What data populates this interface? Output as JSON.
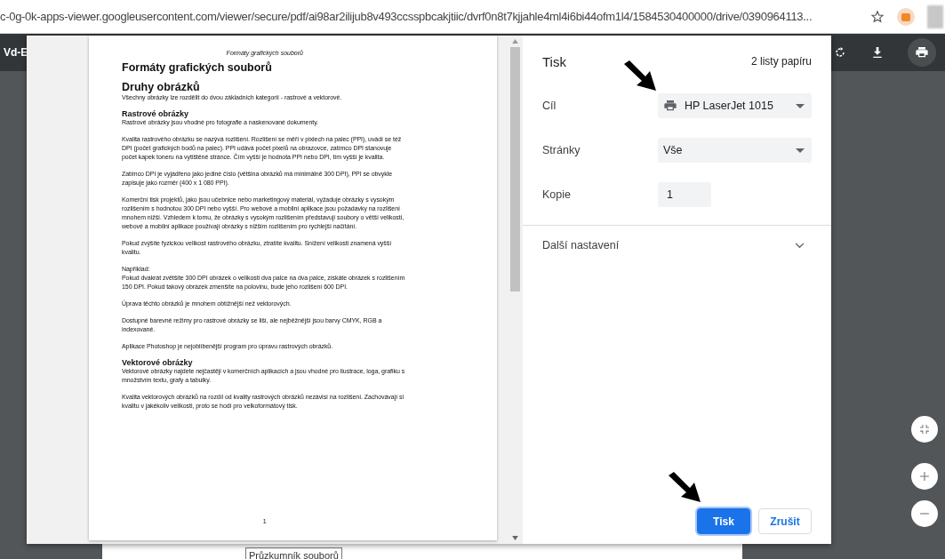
{
  "address_bar": {
    "url": "c-0g-0k-apps-viewer.googleusercontent.com/viewer/secure/pdf/ai98ar2ilijub8v493ccsspbcakjtiic/dvrf0n8t7kjjahle4ml4i6bi44ofm1l4/1584530400000/drive/0390964113..."
  },
  "viewer_toolbar": {
    "title": "Vd-E"
  },
  "document": {
    "header": "Formáty grafických souborů",
    "page_number": "1",
    "blocks": [
      {
        "kind": "title",
        "text": "Formáty grafických souborů"
      },
      {
        "kind": "heading",
        "text": "Druhy obrázků"
      },
      {
        "kind": "paragraph",
        "text": "Všechny obrázky lze rozdělit do dvou základních kategorií - rastrové a vektorové."
      },
      {
        "kind": "subheading",
        "text": "Rastrové obrázky"
      },
      {
        "kind": "paragraph",
        "text": "Rastrové obrázky jsou vhodné pro fotografie a naskenované dokumenty."
      },
      {
        "kind": "paragraph",
        "text": "Kvalita rastrového obrázku se nazývá rozlišení. Rozlišení se měří v pixlech na palec (PPI), uvádí se též DPI (počet grafických bodů na palec). PPI udává počet pixelů na obrazovce, zatímco DPI stanovuje počet kapek toneru na vytištěné stránce. Čím vyšší je hodnota PPI nebo DPI, tím vyšší je kvalita."
      },
      {
        "kind": "paragraph",
        "text": "Zatímco DPI je vyjádřeno jako jediné číslo (většina obrázků má minimálně 300 DPI), PPI se obvykle zapisuje jako rozměr (400 x 1 080 PPI)."
      },
      {
        "kind": "paragraph",
        "text": "Komerční tisk projektů, jako jsou učebnice nebo marketingový materiál, vyžaduje obrázky s vysokým rozlišením s hodnotou 300 DPI nebo vyšší. Pro webové a mobilní aplikace jsou požadavky na rozlišení mnohem nižší. Vzhledem k tomu, že obrázky s vysokým rozlišením představují soubory o větší velikosti, webové a mobilní aplikace používají obrázky s nižším rozlišením pro rychlejší načítání."
      },
      {
        "kind": "paragraph",
        "text": "Pokud zvýšíte fyzickou velikost rastrového obrázku, ztratíte kvalitu. Snížení velikosti znamená vyšší kvalitu."
      },
      {
        "kind": "paragraph",
        "text": "Například:\nPokud dvakrát zvětšíte 300 DPI obrázek o velikosti dva palce na dva palce, získáte obrázek s rozlišením 150 DPI.  Pokud takový obrázek zmenšíte na polovinu, bude jeho rozlišení 600 DPI."
      },
      {
        "kind": "paragraph",
        "text": "Úprava těchto obrázků je mnohem obtížnější než vektorových."
      },
      {
        "kind": "paragraph",
        "text": "Dostupné barevné režimy pro rastrové obrázky se liší, ale nejběžnější jsou barvy CMYK, RGB a indexované."
      },
      {
        "kind": "paragraph",
        "text": "Aplikace Photoshop je nejoblíbenější program pro úpravu rastrových obrázků."
      },
      {
        "kind": "subheading",
        "text": "Vektorové obrázky"
      },
      {
        "kind": "paragraph",
        "text": "Vektorové obrázky najdete nejčastěji v komerčních aplikacích a jsou vhodné pro ilustrace, loga, grafiku s množstvím textu, grafy a tabulky."
      },
      {
        "kind": "paragraph",
        "text": "Kvalita vektorových obrázků na rozdíl od kvality rastrových obrázků nezávisí na rozlišení. Zachovávají si kvalitu v jakékoliv velikosti, proto se hodí pro velkoformátový tisk."
      }
    ]
  },
  "print_dialog": {
    "title": "Tisk",
    "sheets": "2 listy papíru",
    "fields": [
      {
        "label": "Cíl",
        "kind": "select",
        "value": "HP LaserJet 1015",
        "printer": true
      },
      {
        "label": "Stránky",
        "kind": "select",
        "value": "Vše"
      },
      {
        "label": "Kopie",
        "kind": "number",
        "value": "1"
      }
    ],
    "more_settings": {
      "label": "Další nastavení",
      "expanded": false
    },
    "buttons": [
      {
        "label": "Tisk",
        "kind": "primary"
      },
      {
        "label": "Zrušit",
        "kind": "secondary"
      }
    ]
  },
  "tooltip": "Průzkumník souborů"
}
